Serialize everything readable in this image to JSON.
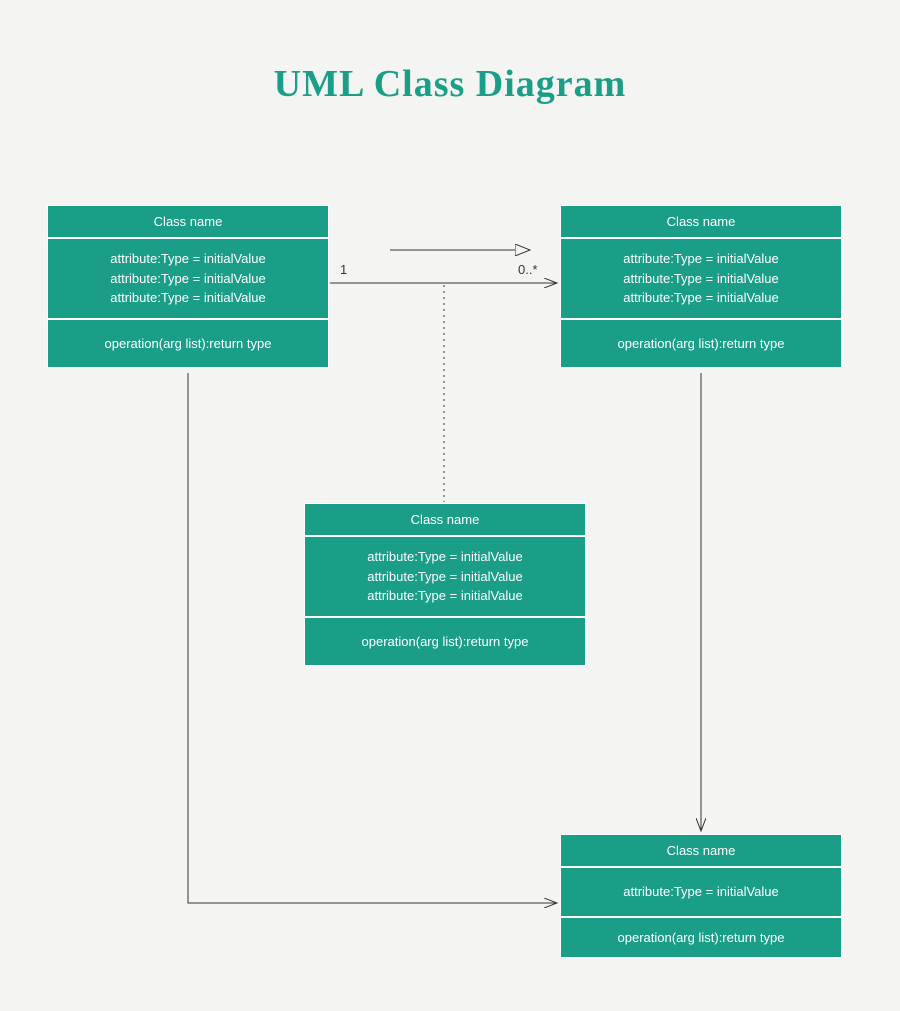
{
  "title": "UML Class Diagram",
  "multiplicity": {
    "source": "1",
    "target": "0..*"
  },
  "classes": [
    {
      "name": "Class name",
      "attributes": [
        "attribute:Type = initialValue",
        "attribute:Type = initialValue",
        "attribute:Type = initialValue"
      ],
      "operations": [
        "operation(arg list):return type"
      ]
    },
    {
      "name": "Class name",
      "attributes": [
        "attribute:Type = initialValue",
        "attribute:Type = initialValue",
        "attribute:Type = initialValue"
      ],
      "operations": [
        "operation(arg list):return type"
      ]
    },
    {
      "name": "Class name",
      "attributes": [
        "attribute:Type = initialValue",
        "attribute:Type = initialValue",
        "attribute:Type = initialValue"
      ],
      "operations": [
        "operation(arg list):return type"
      ]
    },
    {
      "name": "Class name",
      "attributes": [
        "attribute:Type = initialValue"
      ],
      "operations": [
        "operation(arg list):return type"
      ]
    }
  ]
}
